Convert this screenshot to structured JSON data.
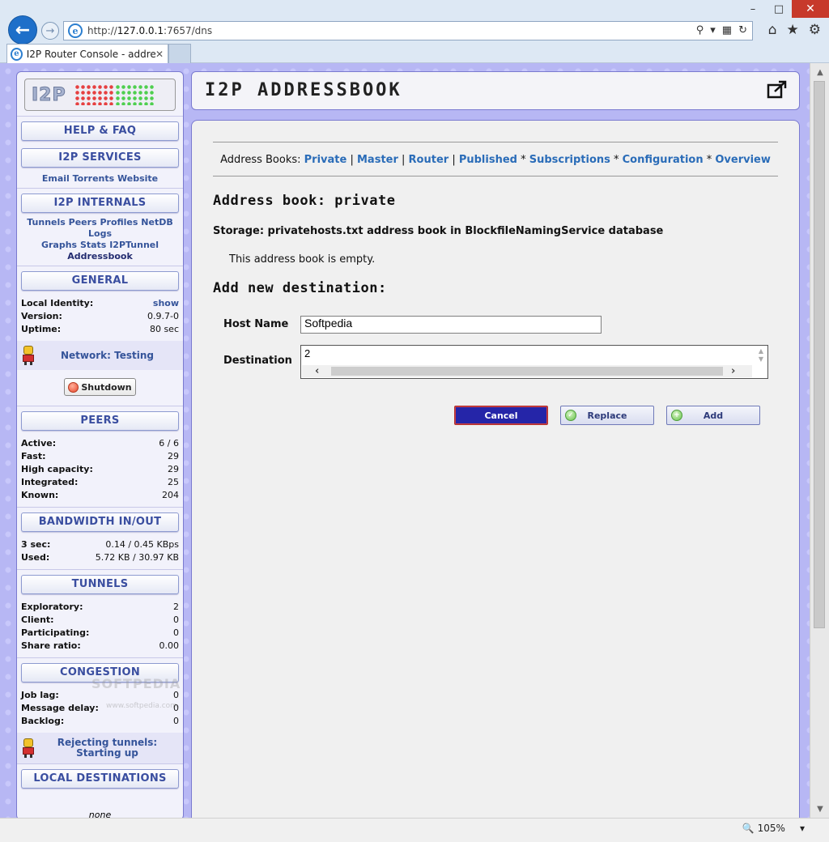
{
  "browser": {
    "url_prefix": "http://",
    "url_host": "127.0.0.1",
    "url_rest": ":7657/dns",
    "tab_title": "I2P Router Console - addres...",
    "zoom": "105%"
  },
  "sidebar": {
    "logo": "I2P",
    "help_label": "HELP & FAQ",
    "services_label": "I2P SERVICES",
    "services_links": [
      "Email",
      "Torrents",
      "Website"
    ],
    "internals_label": "I2P INTERNALS",
    "internals_links": [
      "Tunnels",
      "Peers",
      "Profiles",
      "NetDB",
      "Logs",
      "Graphs",
      "Stats",
      "I2PTunnel"
    ],
    "internals_current": "Addressbook",
    "general_label": "GENERAL",
    "general": {
      "local_identity_k": "Local Identity:",
      "local_identity_v": "show",
      "version_k": "Version:",
      "version_v": "0.9.7-0",
      "uptime_k": "Uptime:",
      "uptime_v": "80 sec"
    },
    "network_status": "Network: Testing",
    "shutdown_label": "Shutdown",
    "peers_label": "PEERS",
    "peers": [
      {
        "k": "Active:",
        "v": "6 / 6"
      },
      {
        "k": "Fast:",
        "v": "29"
      },
      {
        "k": "High capacity:",
        "v": "29"
      },
      {
        "k": "Integrated:",
        "v": "25"
      },
      {
        "k": "Known:",
        "v": "204"
      }
    ],
    "bandwidth_label": "BANDWIDTH IN/OUT",
    "bandwidth": [
      {
        "k": "3 sec:",
        "v": "0.14 / 0.45 KBps"
      },
      {
        "k": "Used:",
        "v": "5.72 KB / 30.97 KB"
      }
    ],
    "tunnels_label": "TUNNELS",
    "tunnels": [
      {
        "k": "Exploratory:",
        "v": "2"
      },
      {
        "k": "Client:",
        "v": "0"
      },
      {
        "k": "Participating:",
        "v": "0"
      },
      {
        "k": "Share ratio:",
        "v": "0.00"
      }
    ],
    "congestion_label": "CONGESTION",
    "congestion": [
      {
        "k": "Job lag:",
        "v": "0"
      },
      {
        "k": "Message delay:",
        "v": "0"
      },
      {
        "k": "Backlog:",
        "v": "0"
      }
    ],
    "tunnel_status": "Rejecting tunnels: Starting up",
    "local_dest_label": "LOCAL DESTINATIONS",
    "local_dest_value": "none",
    "watermark": "SOFTPEDIA",
    "watermark_url": "www.softpedia.com"
  },
  "main": {
    "title": "I2P ADDRESSBOOK",
    "nav_label": "Address Books:",
    "nav_private": "Private",
    "nav_master": "Master",
    "nav_router": "Router",
    "nav_published": "Published",
    "nav_subscriptions": "Subscriptions",
    "nav_configuration": "Configuration",
    "nav_overview": "Overview",
    "book_heading": "Address book: private",
    "storage": "Storage: privatehosts.txt address book in BlockfileNamingService database",
    "empty_msg": "This address book is empty.",
    "add_heading": "Add new destination:",
    "host_label": "Host Name",
    "host_value": "Softpedia",
    "dest_label": "Destination",
    "dest_value": "2",
    "cancel_label": "Cancel",
    "replace_label": "Replace",
    "add_label": "Add"
  }
}
